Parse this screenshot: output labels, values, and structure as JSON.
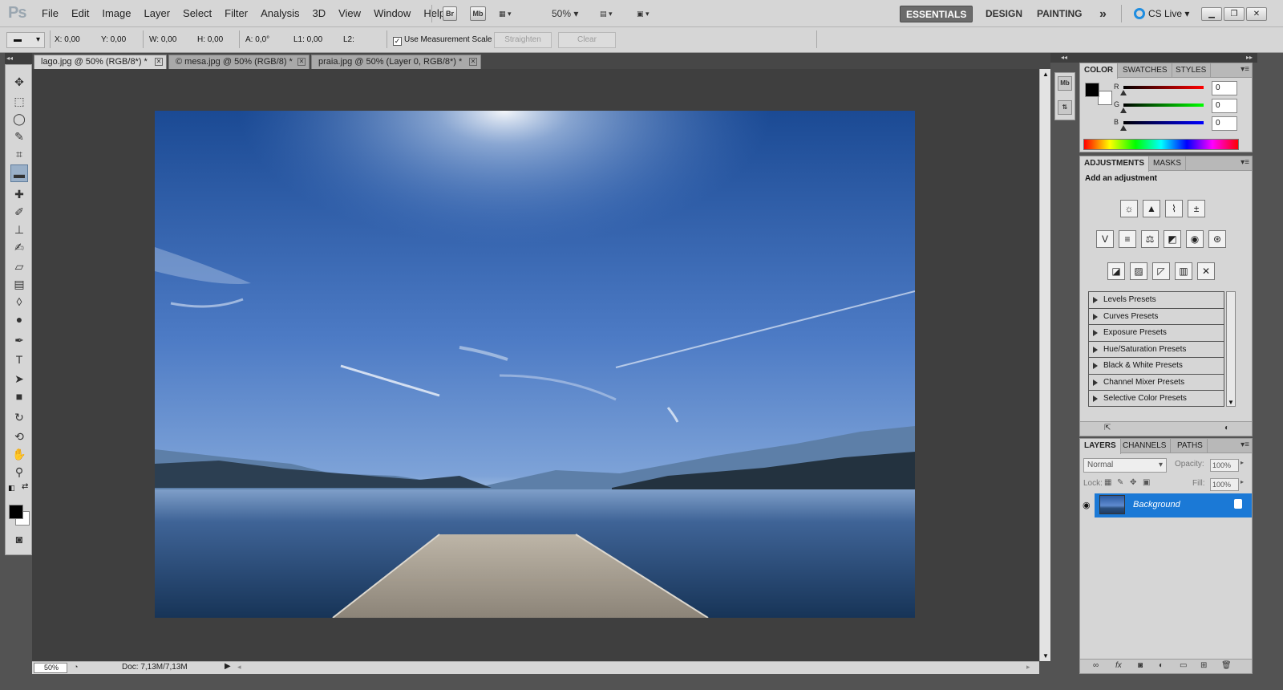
{
  "app": {
    "logo": "Ps"
  },
  "menu": [
    "File",
    "Edit",
    "Image",
    "Layer",
    "Select",
    "Filter",
    "Analysis",
    "3D",
    "View",
    "Window",
    "Help"
  ],
  "appbar": {
    "bridge": "Br",
    "mini_bridge": "Mb",
    "zoom": "50%"
  },
  "workspaces": {
    "essentials": "ESSENTIALS",
    "design": "DESIGN",
    "painting": "PAINTING",
    "more": "»"
  },
  "cslive": "CS Live",
  "options": {
    "x": "X: 0,00",
    "y": "Y: 0,00",
    "w": "W: 0,00",
    "h": "H: 0,00",
    "angle": "A: 0,0°",
    "l1": "L1: 0,00",
    "l2": "L2:",
    "use_scale": "Use Measurement Scale",
    "straighten": "Straighten",
    "clear": "Clear"
  },
  "tabs": [
    {
      "label": "lago.jpg @ 50% (RGB/8*) *"
    },
    {
      "label": "© mesa.jpg @ 50% (RGB/8) *"
    },
    {
      "label": "praia.jpg @ 50% (Layer 0, RGB/8*) *"
    }
  ],
  "status": {
    "zoom": "50%",
    "doc": "Doc: 7,13M/7,13M"
  },
  "color_panel": {
    "tabs": [
      "COLOR",
      "SWATCHES",
      "STYLES"
    ],
    "r_label": "R",
    "g_label": "G",
    "b_label": "B",
    "r": "0",
    "g": "0",
    "b": "0"
  },
  "adjustments": {
    "tabs": [
      "ADJUSTMENTS",
      "MASKS"
    ],
    "title": "Add an adjustment",
    "presets": [
      "Levels Presets",
      "Curves Presets",
      "Exposure Presets",
      "Hue/Saturation Presets",
      "Black & White Presets",
      "Channel Mixer Presets",
      "Selective Color Presets"
    ]
  },
  "layers": {
    "tabs": [
      "LAYERS",
      "CHANNELS",
      "PATHS"
    ],
    "blend": "Normal",
    "opacity_label": "Opacity:",
    "opacity": "100%",
    "lock_label": "Lock:",
    "fill_label": "Fill:",
    "fill": "100%",
    "items": [
      {
        "name": "Background"
      }
    ]
  }
}
